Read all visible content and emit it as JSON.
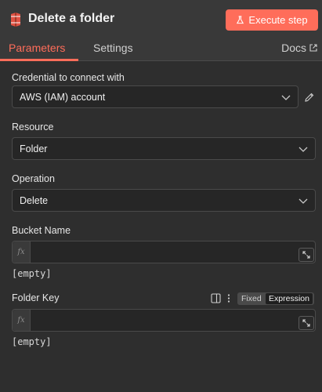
{
  "header": {
    "title": "Delete a folder",
    "execute_label": "Execute step",
    "node_icon": "aws-s3-icon",
    "accent_color": "#ff6d5a"
  },
  "tabs": {
    "items": [
      {
        "label": "Parameters",
        "active": true
      },
      {
        "label": "Settings",
        "active": false
      }
    ],
    "docs_label": "Docs"
  },
  "fields": {
    "credential": {
      "label": "Credential to connect with",
      "value": "AWS (IAM) account"
    },
    "resource": {
      "label": "Resource",
      "value": "Folder"
    },
    "operation": {
      "label": "Operation",
      "value": "Delete"
    },
    "bucket_name": {
      "label": "Bucket Name",
      "fx_label": "fx",
      "value": "",
      "hint": "[empty]"
    },
    "folder_key": {
      "label": "Folder Key",
      "fx_label": "fx",
      "value": "",
      "hint": "[empty]",
      "mode_options": [
        "Fixed",
        "Expression"
      ],
      "mode_selected": "Expression"
    }
  }
}
